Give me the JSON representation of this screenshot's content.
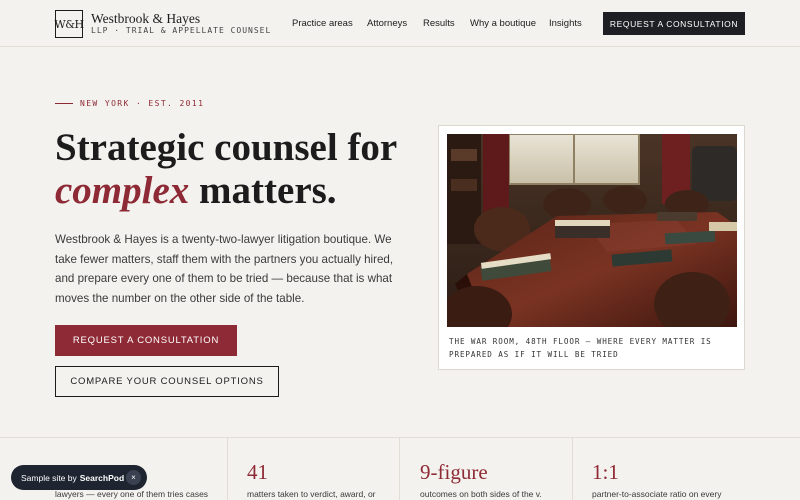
{
  "brand": {
    "mark": "W&H",
    "name": "Westbrook & Hayes",
    "sub": "LLP · TRIAL & APPELLATE COUNSEL"
  },
  "nav": {
    "items": [
      "Practice areas",
      "Attorneys",
      "Results",
      "Why a boutique",
      "Insights"
    ],
    "cta": "REQUEST A CONSULTATION"
  },
  "hero": {
    "eyebrow": "NEW YORK · EST. 2011",
    "headline_line1": "Strategic counsel for",
    "headline_accent": "complex",
    "headline_rest": " matters.",
    "lede": "Westbrook & Hayes is a twenty-two-lawyer litigation boutique. We take fewer matters, staff them with the partners you actually hired, and prepare every one of them to be tried — because that is what moves the number on the other side of the table.",
    "primary_button": "REQUEST A CONSULTATION",
    "secondary_button": "COMPARE YOUR COUNSEL OPTIONS"
  },
  "photo": {
    "caption": "THE WAR ROOM, 48TH FLOOR — WHERE EVERY MATTER IS PREPARED AS IF IT WILL BE TRIED"
  },
  "stats": [
    {
      "value": "",
      "desc": "lawyers — every one of them tries cases"
    },
    {
      "value": "41",
      "desc": "matters taken to verdict, award, or"
    },
    {
      "value": "9-figure",
      "desc": "outcomes on both sides of the v."
    },
    {
      "value": "1:1",
      "desc": "partner-to-associate ratio on every"
    }
  ],
  "toast": {
    "prefix": "Sample site by",
    "brand": "SearchPod",
    "close": "×"
  },
  "colors": {
    "accent": "#8e2a35",
    "dark": "#1d1f24",
    "background": "#f4f2ee"
  }
}
